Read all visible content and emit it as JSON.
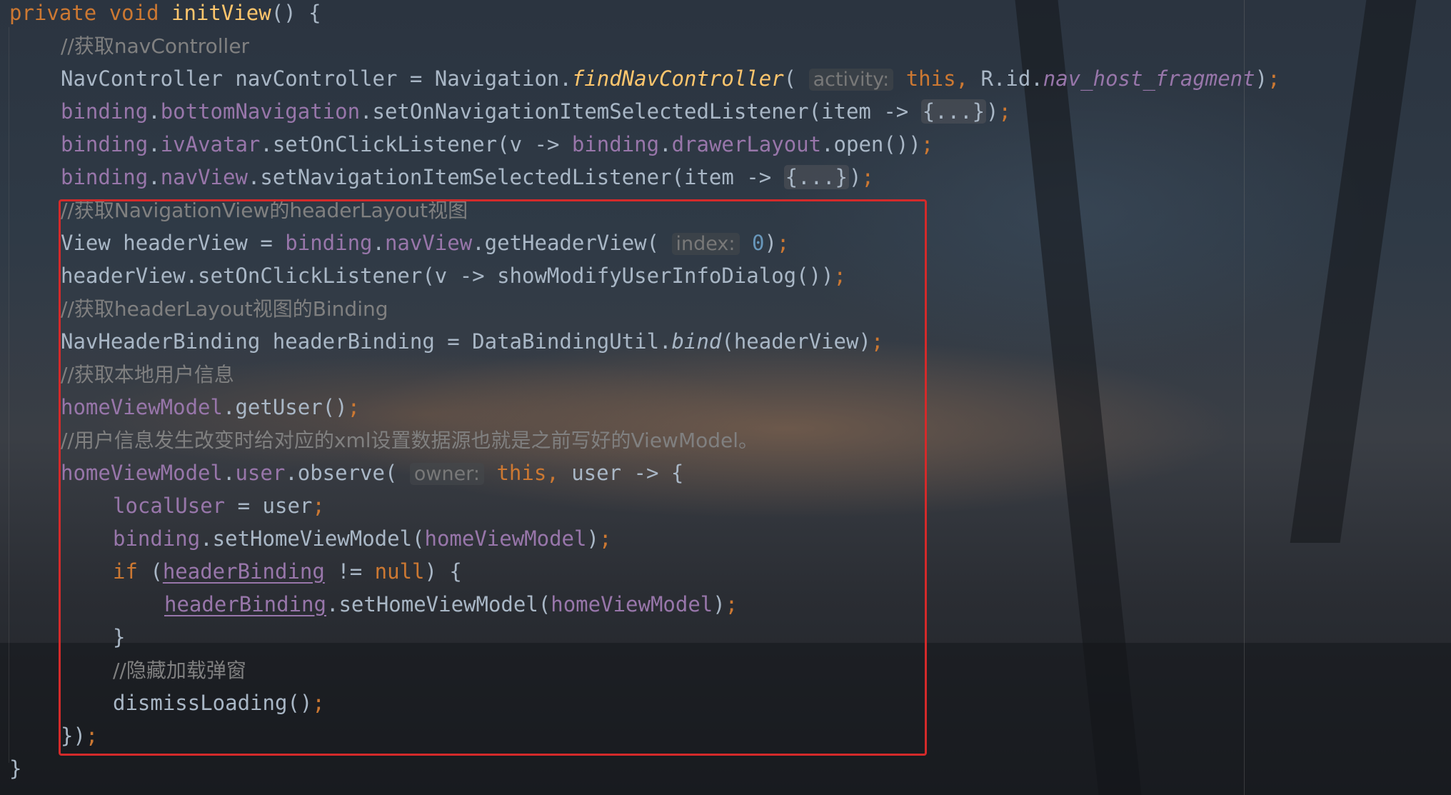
{
  "colors": {
    "keyword": "#cc7832",
    "method": "#ffc66d",
    "field": "#9876aa",
    "comment": "#808080",
    "number": "#6897bb",
    "text": "#a9b7c6",
    "highlight_border": "#d42a2a"
  },
  "code": {
    "l1": {
      "kw1": "private",
      "kw2": "void",
      "method": "initView",
      "rest": "() {"
    },
    "l2": {
      "comment": "//获取navController"
    },
    "l3": {
      "a": "NavController navController = Navigation.",
      "method": "findNavController",
      "b": "( ",
      "hint": "activity:",
      "kw": "this,",
      "c": " R.id.",
      "field": "nav_host_fragment",
      "d": ")",
      "semi": ";"
    },
    "l4": {
      "f1": "binding",
      "dot1": ".",
      "f2": "bottomNavigation",
      "a": ".setOnNavigationItemSelectedListener(item -> ",
      "fold": "{...}",
      "b": ")",
      "semi": ";"
    },
    "l5": {
      "f1": "binding",
      "dot1": ".",
      "f2": "ivAvatar",
      "a": ".setOnClickListener(v -> ",
      "f3": "binding",
      "dot2": ".",
      "f4": "drawerLayout",
      "b": ".open())",
      "semi": ";"
    },
    "l6": {
      "f1": "binding",
      "dot1": ".",
      "f2": "navView",
      "a": ".setNavigationItemSelectedListener(item -> ",
      "fold": "{...}",
      "b": ")",
      "semi": ";"
    },
    "l7": {
      "comment": "//获取NavigationView的headerLayout视图"
    },
    "l8": {
      "a": "View headerView = ",
      "f1": "binding",
      "dot1": ".",
      "f2": "navView",
      "b": ".getHeaderView( ",
      "hint": "index:",
      "num": "0",
      "c": ")",
      "semi": ";"
    },
    "l9": {
      "a": "headerView.setOnClickListener(v -> showModifyUserInfoDialog())",
      "semi": ";"
    },
    "l10": {
      "comment": "//获取headerLayout视图的Binding"
    },
    "l11": {
      "a": "NavHeaderBinding headerBinding = DataBindingUtil.",
      "method": "bind",
      "b": "(headerView)",
      "semi": ";"
    },
    "l12": {
      "comment": "//获取本地用户信息"
    },
    "l13": {
      "f1": "homeViewModel",
      "a": ".getUser()",
      "semi": ";"
    },
    "l14": {
      "comment": "//用户信息发生改变时给对应的xml设置数据源也就是之前写好的ViewModel。"
    },
    "l15": {
      "f1": "homeViewModel",
      "dot1": ".",
      "f2": "user",
      "a": ".observe( ",
      "hint": "owner:",
      "kw": "this,",
      "b": " user -> {"
    },
    "l16": {
      "f1": "localUser",
      "a": " = user",
      "semi": ";"
    },
    "l17": {
      "f1": "binding",
      "a": ".setHomeViewModel(",
      "f2": "homeViewModel",
      "b": ")",
      "semi": ";"
    },
    "l18": {
      "kw1": "if",
      "a": " (",
      "f1": "headerBinding",
      "b": " != ",
      "kw2": "null",
      "c": ") {"
    },
    "l19": {
      "f1": "headerBinding",
      "a": ".setHomeViewModel(",
      "f2": "homeViewModel",
      "b": ")",
      "semi": ";"
    },
    "l20": {
      "a": "}"
    },
    "l21": {
      "comment": "//隐藏加载弹窗"
    },
    "l22": {
      "a": "dismissLoading()",
      "semi": ";"
    },
    "l23": {
      "a": "})",
      "semi": ";"
    },
    "l24": {
      "a": "}"
    }
  }
}
